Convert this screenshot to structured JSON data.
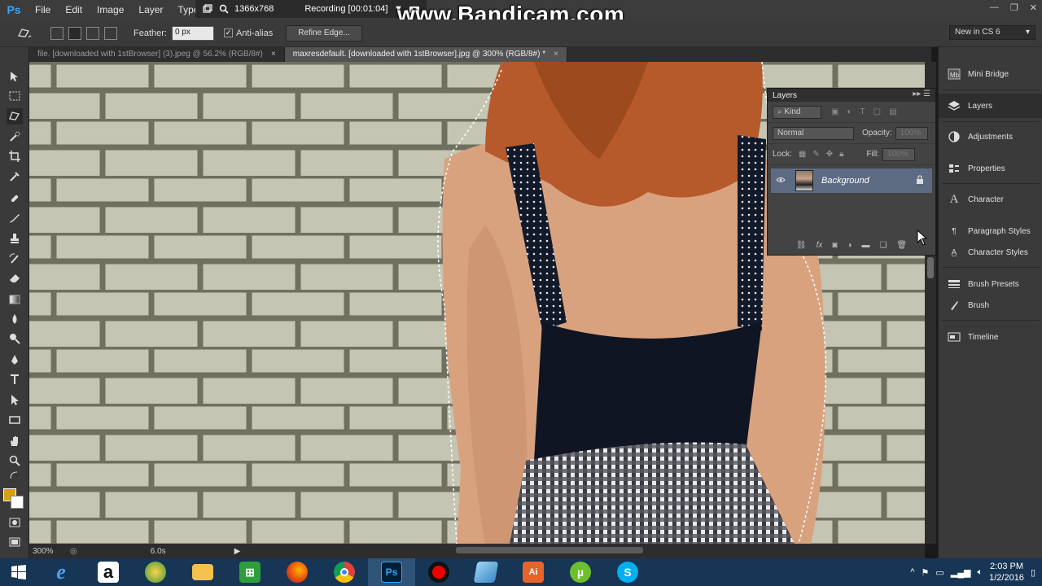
{
  "app": {
    "logo": "Ps"
  },
  "menu": [
    "File",
    "Edit",
    "Image",
    "Layer",
    "Type"
  ],
  "recorder": {
    "resolution": "1366x768",
    "status": "Recording [00:01:04]",
    "watermark": "www.Bandicam.com"
  },
  "options": {
    "feather_label": "Feather:",
    "feather_value": "0 px",
    "antialias_label": "Anti-alias",
    "antialias_checked": true,
    "refine_button": "Refine Edge...",
    "workspace": "New in CS 6"
  },
  "tabs": [
    {
      "label": "file. [downloaded with 1stBrowser] (3).jpeg @ 56.2% (RGB/8#)",
      "close": "×",
      "active": false
    },
    {
      "label": "maxresdefault. [downloaded with 1stBrowser].jpg @ 300% (RGB/8#) *",
      "close": "×",
      "active": true
    }
  ],
  "status": {
    "zoom": "300%",
    "time": "6.0s"
  },
  "colors": {
    "foreground": "#d4a017",
    "background": "#ffffff",
    "selected_layer": "#5c6a82"
  },
  "layers_panel": {
    "title": "Layers",
    "filter_kind": "Kind",
    "blend_mode": "Normal",
    "opacity_label": "Opacity:",
    "opacity_value": "100%",
    "lock_label": "Lock:",
    "fill_label": "Fill:",
    "fill_value": "100%",
    "layers": [
      {
        "name": "Background",
        "visible": true,
        "locked": true
      }
    ]
  },
  "dock": [
    {
      "label": "Mini Bridge",
      "icon": "mini-bridge-icon"
    },
    {
      "label": "Layers",
      "icon": "layers-icon"
    },
    {
      "label": "Adjustments",
      "icon": "adjustments-icon"
    },
    {
      "label": "Properties",
      "icon": "properties-icon"
    },
    {
      "label": "Character",
      "icon": "character-icon"
    },
    {
      "label": "Paragraph Styles",
      "icon": "paragraph-styles-icon"
    },
    {
      "label": "Character Styles",
      "icon": "character-styles-icon"
    },
    {
      "label": "Brush Presets",
      "icon": "brush-presets-icon"
    },
    {
      "label": "Brush",
      "icon": "brush-icon"
    },
    {
      "label": "Timeline",
      "icon": "timeline-icon"
    }
  ],
  "taskbar": {
    "apps": [
      "start",
      "internet-explorer",
      "amazon",
      "browser",
      "file-explorer",
      "store",
      "firefox",
      "chrome",
      "photoshop",
      "bandicam",
      "paper",
      "adobe-app",
      "utorrent",
      "skype"
    ],
    "clock_time": "2:03 PM",
    "clock_date": "1/2/2016"
  }
}
